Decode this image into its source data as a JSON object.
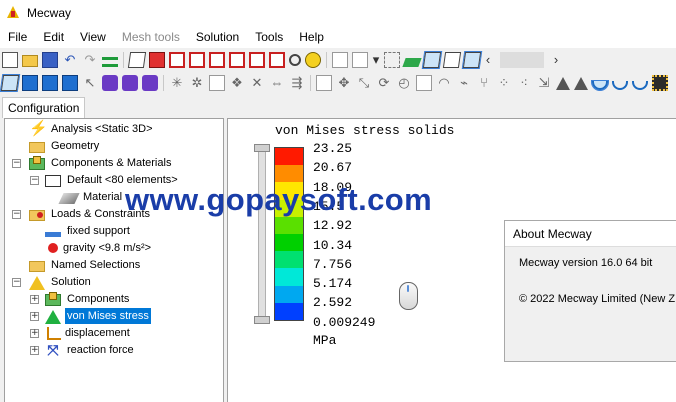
{
  "window": {
    "title": "Mecway"
  },
  "menu": [
    {
      "label": "File",
      "enabled": true
    },
    {
      "label": "Edit",
      "enabled": true
    },
    {
      "label": "View",
      "enabled": true
    },
    {
      "label": "Mesh tools",
      "enabled": false
    },
    {
      "label": "Solution",
      "enabled": true
    },
    {
      "label": "Tools",
      "enabled": true
    },
    {
      "label": "Help",
      "enabled": true
    }
  ],
  "tabs": {
    "configuration": "Configuration"
  },
  "tree": {
    "analysis": "Analysis <Static 3D>",
    "geometry": "Geometry",
    "components_materials": "Components & Materials",
    "default": "Default <80 elements>",
    "material": "Material",
    "loads_constraints": "Loads & Constraints",
    "fixed_support": "fixed support",
    "gravity": "gravity <9.8 m/s²>",
    "named_selections": "Named Selections",
    "solution": "Solution",
    "components": "Components",
    "von_mises": "von Mises stress",
    "displacement": "displacement",
    "reaction_force": "reaction force"
  },
  "legend": {
    "title": "von Mises stress solids",
    "units": "MPa",
    "ticks": [
      "23.25",
      "20.67",
      "18.09",
      "15.5",
      "12.92",
      "10.34",
      "7.756",
      "5.174",
      "2.592",
      "0.009249"
    ],
    "colors": [
      "#ff1a00",
      "#ff8c00",
      "#ffe600",
      "#c8f000",
      "#5ae000",
      "#00d000",
      "#00e070",
      "#00e8d8",
      "#00a8f0",
      "#0040ff"
    ]
  },
  "watermark": "www.gopaysoft.com",
  "about": {
    "title": "About Mecway",
    "version": "Mecway version 16.0 64 bit",
    "copyright": "© 2022 Mecway Limited (New Z"
  },
  "toolbar": {
    "prev_arrow": "‹",
    "next_arrow": "›",
    "dropdown_arrow": "▾"
  }
}
